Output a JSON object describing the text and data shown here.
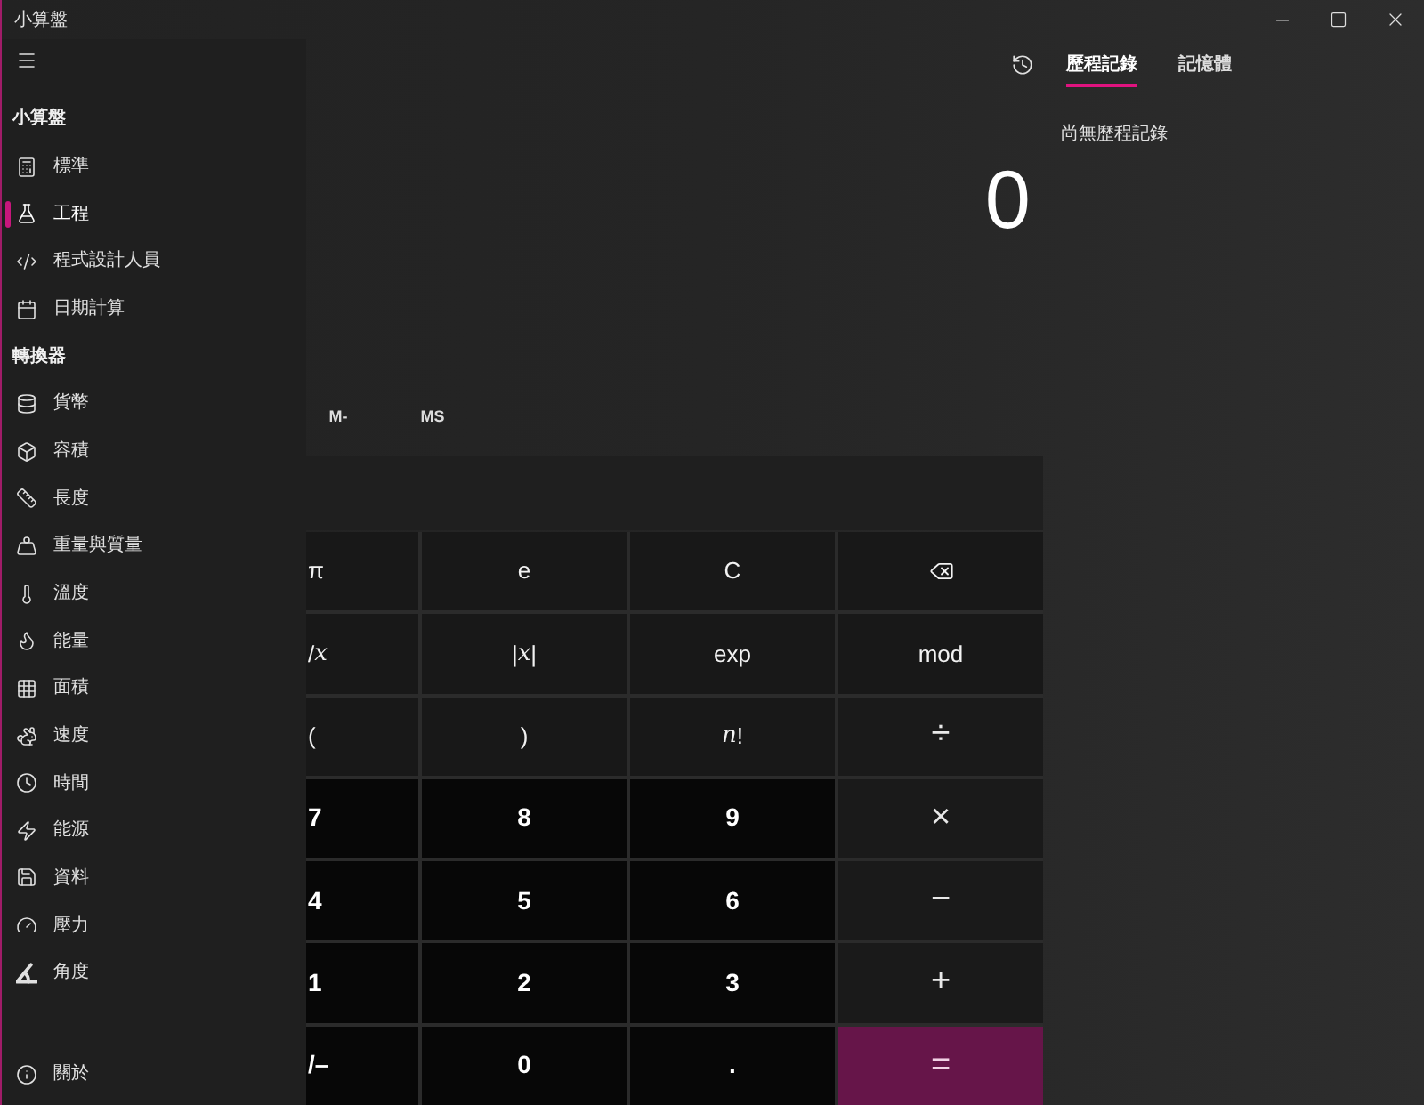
{
  "window": {
    "title": "小算盤"
  },
  "nav": {
    "sections": [
      {
        "header": "小算盤",
        "items": [
          {
            "label": "標準",
            "selected": false
          },
          {
            "label": "工程",
            "selected": true
          },
          {
            "label": "程式設計人員",
            "selected": false
          },
          {
            "label": "日期計算",
            "selected": false
          }
        ]
      },
      {
        "header": "轉換器",
        "items": [
          {
            "label": "貨幣",
            "selected": false
          },
          {
            "label": "容積",
            "selected": false
          },
          {
            "label": "長度",
            "selected": false
          },
          {
            "label": "重量與質量",
            "selected": false
          },
          {
            "label": "溫度",
            "selected": false
          },
          {
            "label": "能量",
            "selected": false
          },
          {
            "label": "面積",
            "selected": false
          },
          {
            "label": "速度",
            "selected": false
          },
          {
            "label": "時間",
            "selected": false
          },
          {
            "label": "能源",
            "selected": false
          },
          {
            "label": "資料",
            "selected": false
          },
          {
            "label": "壓力",
            "selected": false
          },
          {
            "label": "角度",
            "selected": false
          }
        ]
      }
    ],
    "footer_item": {
      "label": "關於"
    }
  },
  "display": {
    "value": "0"
  },
  "memory_buttons": [
    "M-",
    "MS"
  ],
  "keypad": {
    "rows": [
      [
        {
          "kind": "function",
          "label": "π"
        },
        {
          "kind": "function",
          "label": "e"
        },
        {
          "kind": "function",
          "label": "C"
        },
        {
          "kind": "backspace"
        }
      ],
      [
        {
          "kind": "function",
          "label": "/*x*"
        },
        {
          "kind": "function",
          "label": "|*x*|"
        },
        {
          "kind": "function",
          "label": "exp"
        },
        {
          "kind": "function",
          "label": "mod"
        }
      ],
      [
        {
          "kind": "function",
          "label": "("
        },
        {
          "kind": "function",
          "label": ")"
        },
        {
          "kind": "function",
          "label": "*n*!"
        },
        {
          "kind": "operator",
          "label": "÷"
        }
      ],
      [
        {
          "kind": "number",
          "label": "7"
        },
        {
          "kind": "number",
          "label": "8"
        },
        {
          "kind": "number",
          "label": "9"
        },
        {
          "kind": "operator",
          "label": "×"
        }
      ],
      [
        {
          "kind": "number",
          "label": "4"
        },
        {
          "kind": "number",
          "label": "5"
        },
        {
          "kind": "number",
          "label": "6"
        },
        {
          "kind": "operator",
          "label": "−"
        }
      ],
      [
        {
          "kind": "number",
          "label": "1"
        },
        {
          "kind": "number",
          "label": "2"
        },
        {
          "kind": "number",
          "label": "3"
        },
        {
          "kind": "operator",
          "label": "+"
        }
      ],
      [
        {
          "kind": "number",
          "label": "/–"
        },
        {
          "kind": "number",
          "label": "0"
        },
        {
          "kind": "number",
          "label": "."
        },
        {
          "kind": "equals",
          "label": "="
        }
      ]
    ]
  },
  "history_panel": {
    "tabs": [
      {
        "label": "歷程記錄",
        "selected": true
      },
      {
        "label": "記憶體",
        "selected": false
      }
    ],
    "empty_message": "尚無歷程記錄"
  }
}
